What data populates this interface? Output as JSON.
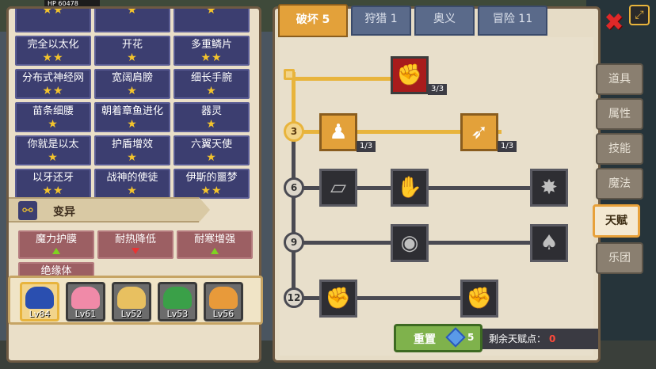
{
  "hud": {
    "hp_label": "HP",
    "hp_value": "60478"
  },
  "skills": [
    {
      "name": "",
      "stars": "★★"
    },
    {
      "name": "",
      "stars": "★"
    },
    {
      "name": "",
      "stars": "★"
    },
    {
      "name": "完全以太化",
      "stars": "★★"
    },
    {
      "name": "开花",
      "stars": "★"
    },
    {
      "name": "多重鳞片",
      "stars": "★★"
    },
    {
      "name": "分布式神经网",
      "stars": "★★"
    },
    {
      "name": "宽阔肩膀",
      "stars": "★"
    },
    {
      "name": "细长手腕",
      "stars": "★"
    },
    {
      "name": "苗条细腰",
      "stars": "★"
    },
    {
      "name": "朝着章鱼进化",
      "stars": "★"
    },
    {
      "name": "器灵",
      "stars": "★"
    },
    {
      "name": "你就是以太",
      "stars": "★"
    },
    {
      "name": "护盾增效",
      "stars": "★"
    },
    {
      "name": "六翼天使",
      "stars": "★"
    },
    {
      "name": "以牙还牙",
      "stars": "★★"
    },
    {
      "name": "战神的使徒",
      "stars": "★"
    },
    {
      "name": "伊斯的噩梦",
      "stars": "★★"
    }
  ],
  "mutation": {
    "header": "变异",
    "items": [
      {
        "name": "魔力护膜",
        "dir": "up"
      },
      {
        "name": "耐热降低",
        "dir": "down"
      },
      {
        "name": "耐寒增强",
        "dir": "up"
      },
      {
        "name": "绝缘体",
        "dir": ""
      }
    ]
  },
  "heroes": [
    {
      "level": "Lv84",
      "color": "#2a4fb0"
    },
    {
      "level": "Lv61",
      "color": "#f08aa8"
    },
    {
      "level": "Lv52",
      "color": "#e8c060"
    },
    {
      "level": "Lv53",
      "color": "#3aa048"
    },
    {
      "level": "Lv56",
      "color": "#e89a3a"
    }
  ],
  "tabs": [
    "破坏 5",
    "狩猎 1",
    "奥义",
    "冒险 11"
  ],
  "tiers": [
    "",
    "3",
    "6",
    "9",
    "12"
  ],
  "talents": [
    {
      "icon": "arm-wrestle-icon",
      "glyph": "✊",
      "count": "3/3"
    },
    {
      "icon": "muscle-body-icon",
      "glyph": "♟",
      "count": "1/3"
    },
    {
      "icon": "arrow-strike-icon",
      "glyph": "➶",
      "count": "1/3"
    },
    {
      "icon": "crumble-icon",
      "glyph": "▱",
      "count": ""
    },
    {
      "icon": "punch-icon",
      "glyph": "✋",
      "count": ""
    },
    {
      "icon": "splash-icon",
      "glyph": "✸",
      "count": ""
    },
    {
      "icon": "ripple-icon",
      "glyph": "◉",
      "count": ""
    },
    {
      "icon": "bat-wings-icon",
      "glyph": "♠",
      "count": ""
    },
    {
      "icon": "fist-icon",
      "glyph": "✊",
      "count": ""
    },
    {
      "icon": "fist-slam-icon",
      "glyph": "✊",
      "count": ""
    }
  ],
  "reset": {
    "label": "重置",
    "cost": "5"
  },
  "remaining": {
    "label": "剩余天赋点：",
    "value": "0"
  },
  "side_tabs": [
    "道具",
    "属性",
    "技能",
    "魔法",
    "天赋",
    "乐团"
  ],
  "close_glyph": "✖",
  "corner_glyph": "⤢"
}
